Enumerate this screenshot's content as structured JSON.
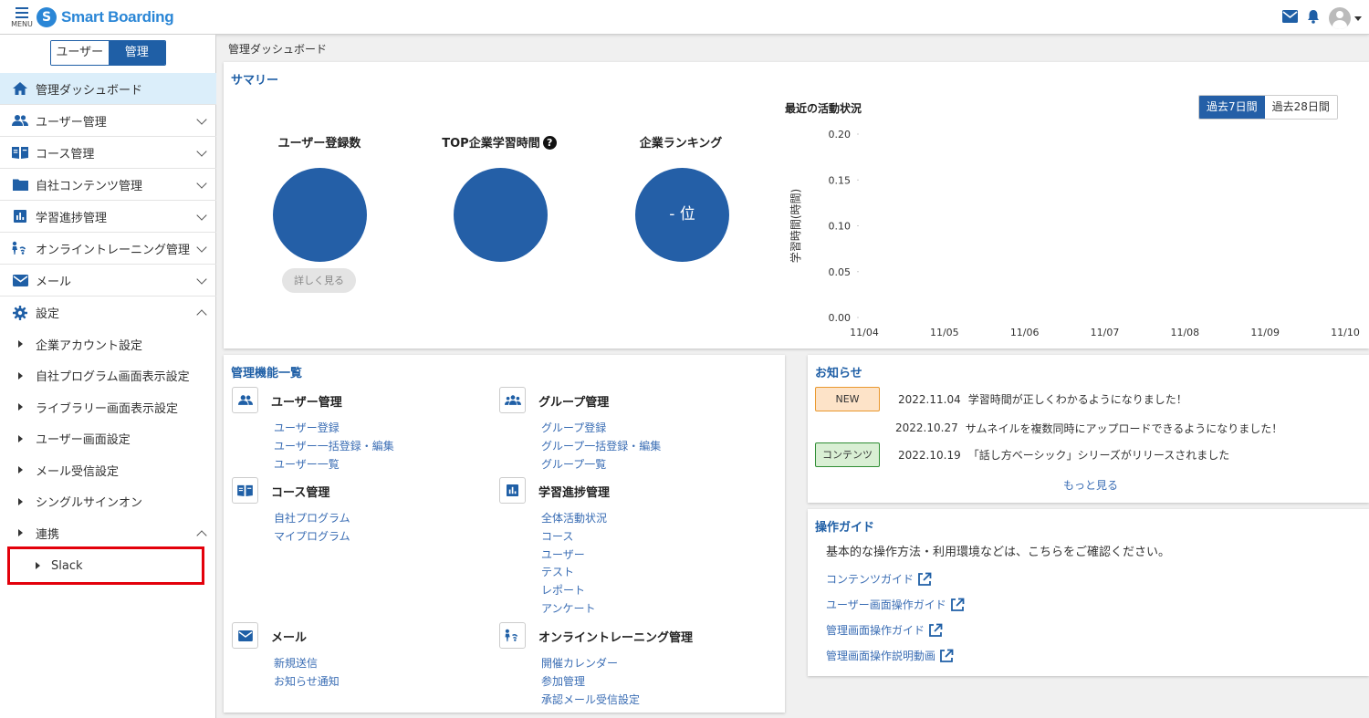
{
  "header": {
    "menu_label": "MENU",
    "logo_text": "Smart Boarding",
    "brand_color": "#2a86d6"
  },
  "sidebar": {
    "mode_toggle": {
      "user": "ユーザー",
      "admin": "管理"
    },
    "nav": [
      {
        "label": "管理ダッシュボード",
        "icon": "home-icon"
      },
      {
        "label": "ユーザー管理",
        "icon": "users-icon"
      },
      {
        "label": "コース管理",
        "icon": "book-icon"
      },
      {
        "label": "自社コンテンツ管理",
        "icon": "folder-icon"
      },
      {
        "label": "学習進捗管理",
        "icon": "bar-chart-icon"
      },
      {
        "label": "オンライントレーニング管理",
        "icon": "online-training-icon"
      },
      {
        "label": "メール",
        "icon": "mail-icon"
      },
      {
        "label": "設定",
        "icon": "gear-icon"
      }
    ],
    "settings_items": [
      "企業アカウント設定",
      "自社プログラム画面表示設定",
      "ライブラリー画面表示設定",
      "ユーザー画面設定",
      "メール受信設定",
      "シングルサインオン",
      "連携"
    ],
    "integration_item": "Slack"
  },
  "breadcrumb": "管理ダッシュボード",
  "summary": {
    "title": "サマリー",
    "metrics": [
      {
        "title": "ユーザー登録数",
        "value": ""
      },
      {
        "title": "TOP企業学習時間",
        "value": ""
      },
      {
        "title": "企業ランキング",
        "value": "- 位"
      }
    ],
    "detail_button": "詳しく見る",
    "activity_title": "最近の活動状況",
    "period_options": [
      "過去7日間",
      "過去28日間"
    ],
    "period_selected": "過去7日間"
  },
  "chart_data": {
    "type": "line",
    "title": "最近の活動状況",
    "ylabel": "学習時間(時間)",
    "xlabel": "",
    "categories": [
      "11/04",
      "11/05",
      "11/06",
      "11/07",
      "11/08",
      "11/09",
      "11/10"
    ],
    "y_ticks": [
      "0.20",
      "0.15",
      "0.10",
      "0.05",
      "0.00"
    ],
    "ylim": [
      0,
      0.2
    ],
    "series": [],
    "grid": false
  },
  "features": {
    "title": "管理機能一覧",
    "groups": [
      {
        "title": "ユーザー管理",
        "icon": "users-icon",
        "links": [
          "ユーザー登録",
          "ユーザー一括登録・編集",
          "ユーザー一覧"
        ]
      },
      {
        "title": "グループ管理",
        "icon": "group-icon",
        "links": [
          "グループ登録",
          "グループ一括登録・編集",
          "グループ一覧"
        ]
      },
      {
        "title": "コース管理",
        "icon": "book-icon",
        "links": [
          "自社プログラム",
          "マイプログラム"
        ]
      },
      {
        "title": "学習進捗管理",
        "icon": "bar-chart-icon",
        "links": [
          "全体活動状況",
          "コース",
          "ユーザー",
          "テスト",
          "レポート",
          "アンケート"
        ]
      },
      {
        "title": "メール",
        "icon": "mail-icon",
        "links": [
          "新規送信",
          "お知らせ通知"
        ]
      },
      {
        "title": "オンライントレーニング管理",
        "icon": "online-training-icon",
        "links": [
          "開催カレンダー",
          "参加管理",
          "承認メール受信設定"
        ]
      }
    ]
  },
  "news": {
    "title": "お知らせ",
    "items": [
      {
        "badge": "NEW",
        "date": "2022.11.04",
        "text": "学習時間が正しくわかるようになりました！"
      },
      {
        "badge": "",
        "date": "2022.10.27",
        "text": "サムネイルを複数同時にアップロードできるようになりました！"
      },
      {
        "badge": "コンテンツ",
        "date": "2022.10.19",
        "text": "「話し方ベーシック」シリーズがリリースされました"
      }
    ],
    "more": "もっと見る"
  },
  "guide": {
    "title": "操作ガイド",
    "description": "基本的な操作方法・利用環境などは、こちらをご確認ください。",
    "links": [
      "コンテンツガイド",
      "ユーザー画面操作ガイド",
      "管理画面操作ガイド",
      "管理画面操作説明動画"
    ]
  },
  "colors": {
    "primary": "#1f5fa6",
    "metric_circle": "#245fa7",
    "link": "#3a6db4",
    "active_nav_bg": "#dbeefa",
    "highlight_border": "#e3000b"
  }
}
